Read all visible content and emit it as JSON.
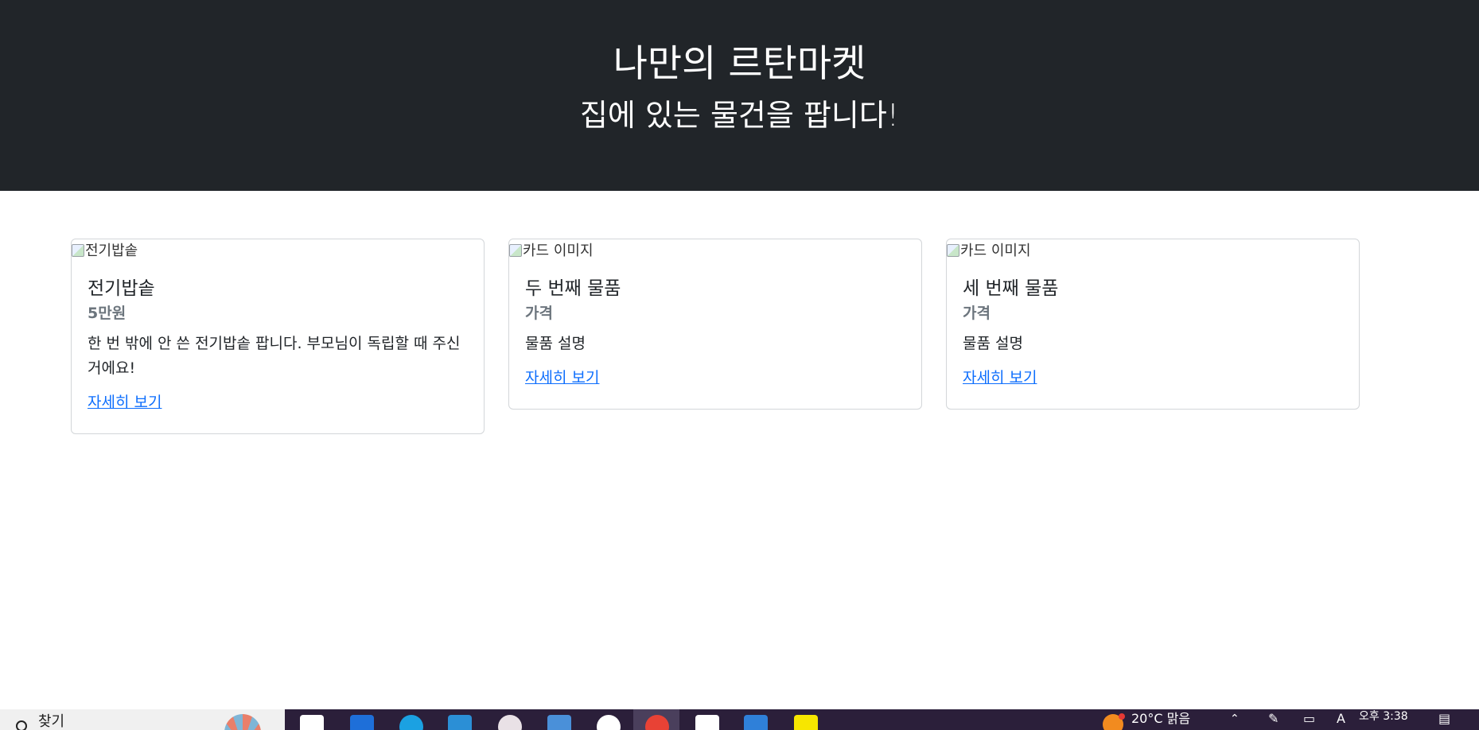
{
  "hero": {
    "title": "나만의 르탄마켓",
    "subtitle": "집에 있는 물건을 팝니다!"
  },
  "cards": [
    {
      "image_alt": "전기밥솥",
      "title": "전기밥솥",
      "price": "5만원",
      "description": "한 번 밖에 안 쓴 전기밥솥 팝니다. 부모님이 독립할 때 주신 거에요!",
      "link": "자세히 보기"
    },
    {
      "image_alt": "카드 이미지",
      "title": "두 번째 물품",
      "price": "가격",
      "description": "물품 설명",
      "link": "자세히 보기"
    },
    {
      "image_alt": "카드 이미지",
      "title": "세 번째 물품",
      "price": "가격",
      "description": "물품 설명",
      "link": "자세히 보기"
    }
  ],
  "taskbar": {
    "search_label": "찾기",
    "weather": "20°C 맑음",
    "clock_period_time": "오후 3:38",
    "pinned_icons": [
      "store-icon",
      "mail-icon",
      "edge-icon",
      "vscode-insiders-icon",
      "app-icon",
      "calendar-icon",
      "slack-icon",
      "chrome-icon",
      "notion-icon",
      "vscode-icon",
      "kakaotalk-icon"
    ],
    "tray_icons": [
      "chevron-up-icon",
      "pen-icon",
      "display-icon",
      "ime-icon",
      "notification-icon"
    ]
  },
  "colors": {
    "hero_bg": "#212529",
    "link": "#0d6efd",
    "muted": "#6c757d",
    "taskbar_bg": "#2b1f3a"
  }
}
